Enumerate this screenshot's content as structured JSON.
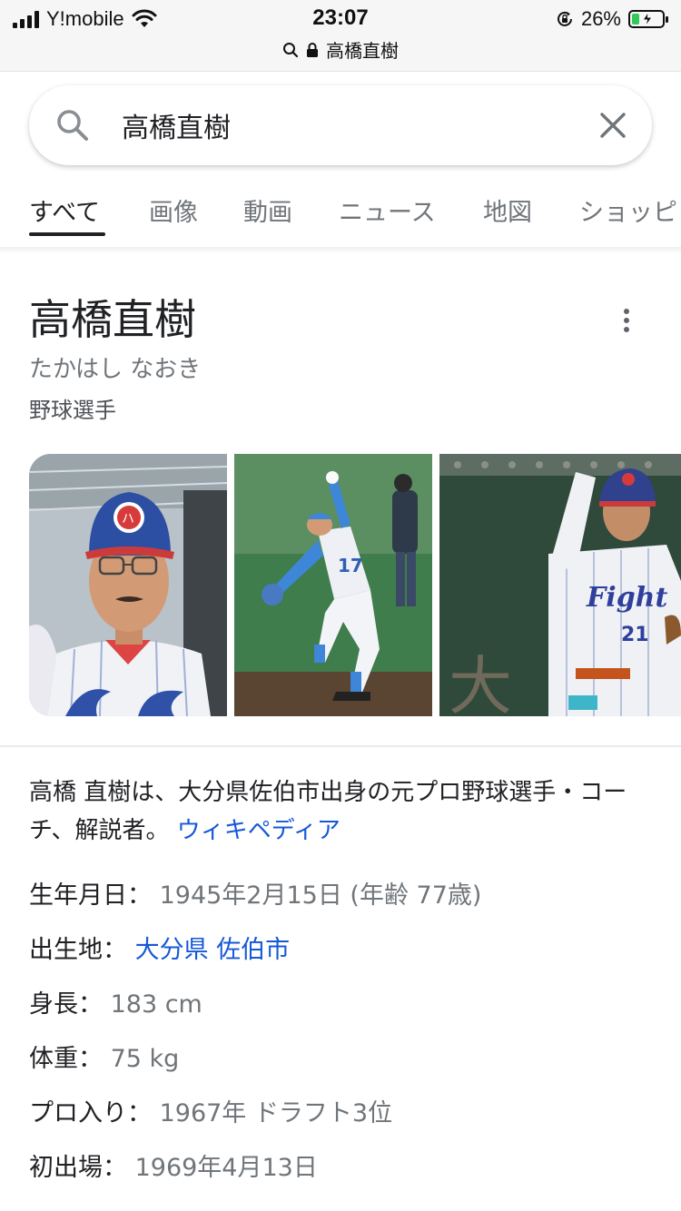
{
  "status_bar": {
    "carrier": "Y!mobile",
    "time": "23:07",
    "url": "高橋直樹",
    "battery_percent": "26%",
    "battery_level": 0.26,
    "icons": [
      "signal-icon",
      "wifi-icon",
      "lock-icon",
      "rotation-lock-icon",
      "battery-charging-icon"
    ]
  },
  "search": {
    "query": "高橋直樹"
  },
  "tabs": [
    {
      "label": "すべて",
      "active": true
    },
    {
      "label": "画像",
      "active": false
    },
    {
      "label": "動画",
      "active": false
    },
    {
      "label": "ニュース",
      "active": false
    },
    {
      "label": "地図",
      "active": false
    },
    {
      "label": "ショッピ",
      "active": false
    }
  ],
  "knowledge_panel": {
    "title": "高橋直樹",
    "reading": "たかはし なおき",
    "type": "野球選手",
    "description": "高橋 直樹は、大分県佐伯市出身の元プロ野球選手・コーチ、解説者。",
    "source_link": "ウィキペディア",
    "facts": [
      {
        "key": "生年月日：",
        "value": "1945年2月15日 (年齢 77歳)",
        "link": false
      },
      {
        "key": "出生地：",
        "value": "大分県 佐伯市",
        "link": true
      },
      {
        "key": "身長：",
        "value": "183 cm",
        "link": false
      },
      {
        "key": "体重：",
        "value": "75 kg",
        "link": false
      },
      {
        "key": "プロ入り：",
        "value": "1967年 ドラフト3位",
        "link": false
      },
      {
        "key": "初出場：",
        "value": "1969年4月13日",
        "link": false
      }
    ]
  },
  "colors": {
    "link": "#1558d6",
    "text": "#202124",
    "secondary": "#70757a"
  }
}
